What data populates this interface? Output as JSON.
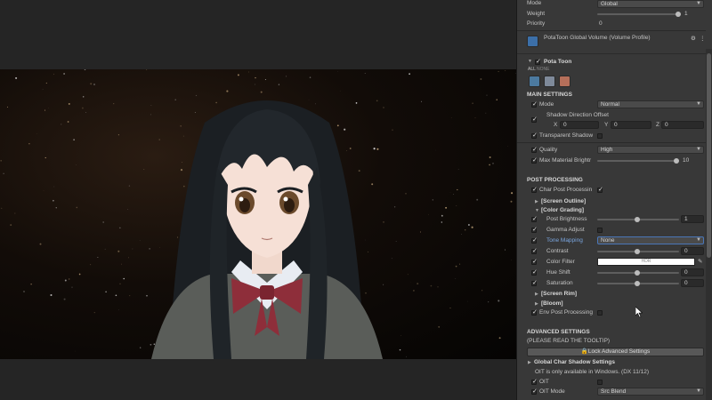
{
  "top": {
    "mode_label": "Mode",
    "mode_value": "Global",
    "weight_label": "Weight",
    "weight_value": "1",
    "weight_level": 1.0,
    "priority_label": "Priority",
    "priority_value": "0"
  },
  "profile": {
    "label": "PotaToon Global Volume (Volume Profile)"
  },
  "component": {
    "title": "Pota Toon",
    "tab_all": "ALL",
    "tab_none": "NONE"
  },
  "main": {
    "header": "MAIN SETTINGS",
    "mode_label": "Mode",
    "mode_value": "Normal",
    "shadow_dir_label": "Shadow Direction Offset",
    "x_label": "X",
    "x_value": "0",
    "y_label": "Y",
    "y_value": "0",
    "z_label": "Z",
    "z_value": "0",
    "transparent_shadow_label": "Transparent Shadow",
    "quality_label": "Quality",
    "quality_value": "High",
    "max_bright_label": "Max Material Brightr",
    "max_bright_value": "10",
    "max_bright_level": 1.0
  },
  "post": {
    "header": "POST PROCESSING",
    "char_post_label": "Char Post Processin",
    "screen_outline": "[Screen Outline]",
    "color_grading": "[Color Grading]",
    "post_brightness_label": "Post Brightness",
    "post_brightness_value": "1",
    "post_brightness_level": 0.5,
    "gamma_label": "Gamma Adjust",
    "tone_mapping_label": "Tone Mapping",
    "tone_mapping_value": "None",
    "contrast_label": "Contrast",
    "contrast_value": "0",
    "contrast_level": 0.5,
    "color_filter_label": "Color Filter",
    "color_filter_badge": "HDR",
    "hue_shift_label": "Hue Shift",
    "hue_shift_value": "0",
    "hue_shift_level": 0.5,
    "saturation_label": "Saturation",
    "saturation_value": "0",
    "saturation_level": 0.5,
    "screen_rim": "[Screen Rim]",
    "bloom": "[Bloom]",
    "env_post_label": "Env Post Processing"
  },
  "advanced": {
    "header": "ADVANCED SETTINGS",
    "note": "(PLEASE READ THE TOOLTIP)",
    "lock_button": "Lock Advanced Settings",
    "shadow_settings": "Global Char Shadow Settings",
    "oit_note": "OIT is only available in Windows. (DX 11/12)",
    "oit_label": "OIT",
    "oit_mode_label": "OIT Mode",
    "oit_mode_value": "Src Blend"
  },
  "colors": {
    "panel_bg": "#383838",
    "field_bg": "#2a2a2a",
    "color_filter": "#ffffff",
    "accent_blue": "#7aa6e0"
  },
  "icons": [
    "ellipsis-icon",
    "settings-icon",
    "volume-profile-icon",
    "hdr-icon",
    "eyedropper-icon"
  ]
}
